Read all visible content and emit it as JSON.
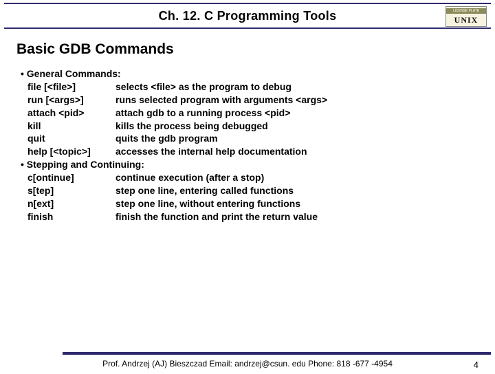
{
  "header": {
    "title": "Ch. 12. C Programming Tools",
    "logo_top": "LICENSE PLATE",
    "logo_main": "UNIX"
  },
  "section_title": "Basic GDB Commands",
  "groups": [
    {
      "heading": "• General Commands:",
      "rows": [
        {
          "cmd": "file [<file>]",
          "desc": "selects <file> as the program to debug"
        },
        {
          "cmd": "run [<args>]",
          "desc": "runs selected program with arguments <args>"
        },
        {
          "cmd": "attach <pid>",
          "desc": "attach gdb to a running process <pid>"
        },
        {
          "cmd": "kill",
          "desc": "kills the process being debugged"
        },
        {
          "cmd": "quit",
          "desc": "quits the gdb program"
        },
        {
          "cmd": "help [<topic>]",
          "desc": "accesses the internal help documentation"
        }
      ]
    },
    {
      "heading": "• Stepping and Continuing:",
      "rows": [
        {
          "cmd": "c[ontinue]",
          "desc": "continue execution (after a stop)"
        },
        {
          "cmd": "s[tep]",
          "desc": "step one line, entering called functions"
        },
        {
          "cmd": "n[ext]",
          "desc": "step one line, without entering functions"
        },
        {
          "cmd": "finish",
          "desc": "finish the function and print the return value"
        }
      ]
    }
  ],
  "footer": {
    "text": "Prof. Andrzej (AJ) Bieszczad Email: andrzej@csun. edu Phone: 818 -677 -4954",
    "page": "4"
  }
}
